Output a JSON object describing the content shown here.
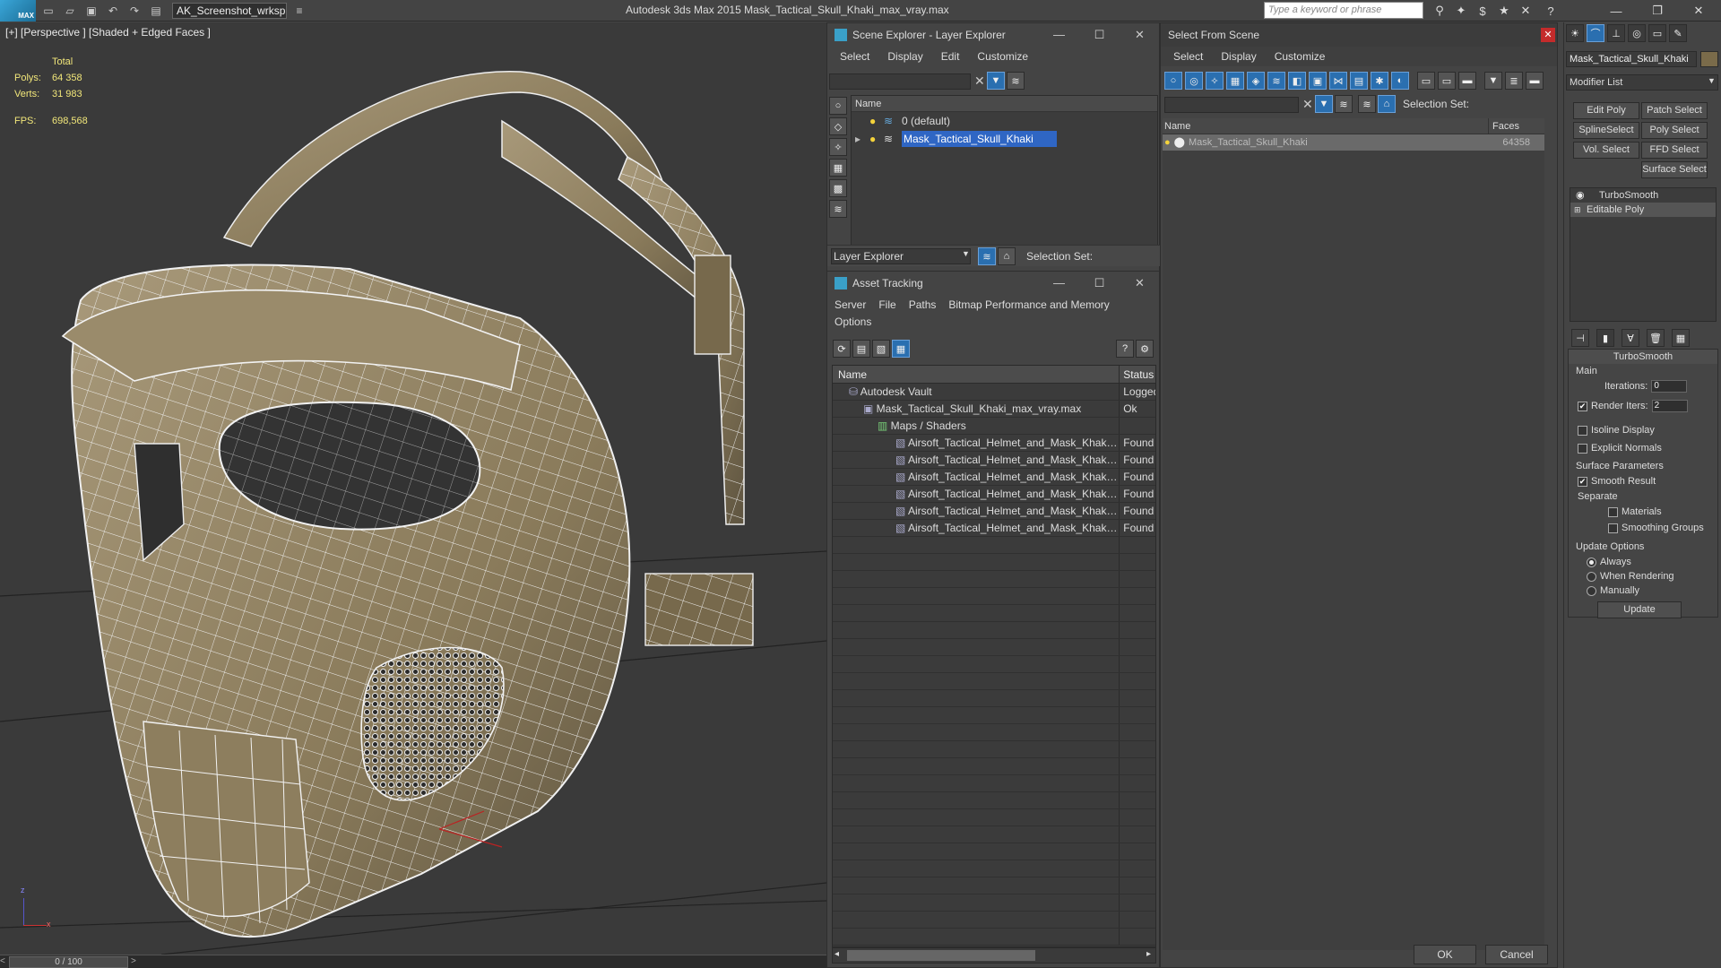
{
  "titlebar": {
    "logo": "MAX",
    "workspace": "AK_Screenshot_wrksp",
    "app_title": "Autodesk 3ds Max  2015    Mask_Tactical_Skull_Khaki_max_vray.max",
    "search_placeholder": "Type a keyword or phrase"
  },
  "viewport": {
    "label": "[+] [Perspective ] [Shaded + Edged Faces ]",
    "stats": {
      "total_label": "Total",
      "polys_label": "Polys:",
      "polys": "64 358",
      "verts_label": "Verts:",
      "verts": "31 983",
      "fps_label": "FPS:",
      "fps": "698,568"
    },
    "axis_z": "z",
    "axis_x": "x",
    "mesh_color": "#8c7d5c"
  },
  "timeline": {
    "value": "0 / 100"
  },
  "scene_explorer": {
    "title": "Scene Explorer - Layer Explorer",
    "menu": [
      "Select",
      "Display",
      "Edit",
      "Customize"
    ],
    "col_name": "Name",
    "rows": [
      "0 (default)",
      "Mask_Tactical_Skull_Khaki"
    ],
    "footer_mode": "Layer Explorer",
    "selection_set": "Selection Set:"
  },
  "asset_tracking": {
    "title": "Asset Tracking",
    "menu": [
      "Server",
      "File",
      "Paths",
      "Bitmap Performance and Memory"
    ],
    "menu2": "Options",
    "col_name": "Name",
    "col_status": "Status",
    "rows": [
      {
        "name": "Autodesk Vault",
        "status": "Logged"
      },
      {
        "name": "Mask_Tactical_Skull_Khaki_max_vray.max",
        "status": "Ok"
      },
      {
        "name": "Maps / Shaders",
        "status": ""
      },
      {
        "name": "Airsoft_Tactical_Helmet_and_Mask_Khaki_...",
        "status": "Found"
      },
      {
        "name": "Airsoft_Tactical_Helmet_and_Mask_Khaki_...",
        "status": "Found"
      },
      {
        "name": "Airsoft_Tactical_Helmet_and_Mask_Khaki_...",
        "status": "Found"
      },
      {
        "name": "Airsoft_Tactical_Helmet_and_Mask_Khaki_...",
        "status": "Found"
      },
      {
        "name": "Airsoft_Tactical_Helmet_and_Mask_Khaki_...",
        "status": "Found"
      },
      {
        "name": "Airsoft_Tactical_Helmet_and_Mask_Khaki_...",
        "status": "Found"
      }
    ]
  },
  "select_from_scene": {
    "title": "Select From Scene",
    "menu": [
      "Select",
      "Display",
      "Customize"
    ],
    "selection_set": "Selection Set:",
    "col_name": "Name",
    "col_faces": "Faces",
    "row_name": "Mask_Tactical_Skull_Khaki",
    "row_faces": "64358",
    "ok": "OK",
    "cancel": "Cancel"
  },
  "command_panel": {
    "object_name": "Mask_Tactical_Skull_Khaki",
    "modifier_list": "Modifier List",
    "buttons": [
      "Edit Poly",
      "Patch Select",
      "SplineSelect",
      "Poly Select",
      "Vol. Select",
      "FFD Select",
      "Surface Select"
    ],
    "stack": [
      "TurboSmooth",
      "Editable Poly"
    ],
    "rollout_title": "TurboSmooth",
    "main": "Main",
    "iterations_label": "Iterations:",
    "iterations": "0",
    "render_iters_label": "Render Iters:",
    "render_iters": "2",
    "isoline": "Isoline Display",
    "explicit_normals": "Explicit Normals",
    "surface_params": "Surface Parameters",
    "smooth_result": "Smooth Result",
    "separate": "Separate",
    "materials": "Materials",
    "smoothing_groups": "Smoothing Groups",
    "update_options": "Update Options",
    "always": "Always",
    "when_rendering": "When Rendering",
    "manually": "Manually",
    "update": "Update"
  }
}
